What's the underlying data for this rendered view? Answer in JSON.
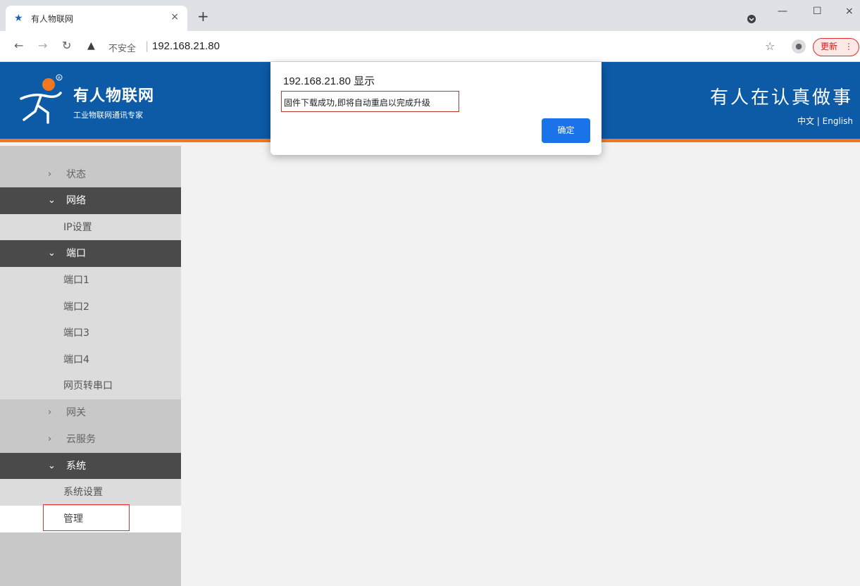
{
  "browser": {
    "tab_title": "有人物联网",
    "tab_close": "×",
    "new_tab": "+",
    "security_label": "不安全",
    "url": "192.168.21.80",
    "update_label": "更新",
    "update_menu": "⋮",
    "window_minimize": "—",
    "window_maximize": "☐",
    "window_close": "×"
  },
  "header": {
    "brand_name": "有人物联网",
    "brand_subtitle": "工业物联网通讯专家",
    "slogan": "有人在认真做事",
    "lang_zh": "中文",
    "lang_sep": "|",
    "lang_en": "English",
    "colors": {
      "header_bg": "#0d5aa7",
      "accent": "#f07920"
    }
  },
  "sidebar": {
    "items": [
      {
        "label": "状态",
        "state": "collapsed"
      },
      {
        "label": "网络",
        "state": "expanded"
      },
      {
        "label": "IP设置",
        "state": "sub"
      },
      {
        "label": "端口",
        "state": "expanded"
      },
      {
        "label": "端口1",
        "state": "sub"
      },
      {
        "label": "端口2",
        "state": "sub"
      },
      {
        "label": "端口3",
        "state": "sub"
      },
      {
        "label": "端口4",
        "state": "sub"
      },
      {
        "label": "网页转串口",
        "state": "sub"
      },
      {
        "label": "网关",
        "state": "collapsed"
      },
      {
        "label": "云服务",
        "state": "collapsed"
      },
      {
        "label": "系统",
        "state": "expanded"
      },
      {
        "label": "系统设置",
        "state": "sub"
      },
      {
        "label": "管理",
        "state": "active"
      }
    ]
  },
  "dialog": {
    "title": "192.168.21.80 显示",
    "message": "固件下载成功,即将自动重启以完成升级",
    "ok_label": "确定"
  }
}
